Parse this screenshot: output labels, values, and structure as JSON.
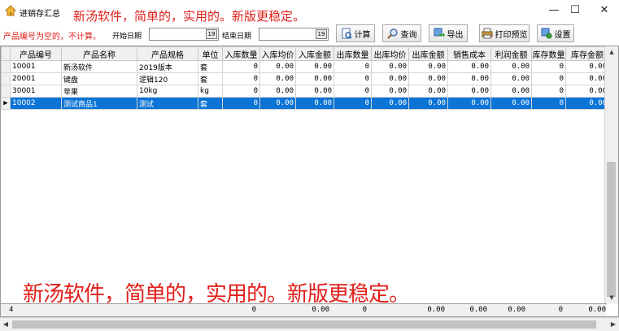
{
  "window": {
    "title": "进销存汇总",
    "banner": "新汤软件，简单的，实用的。新版更稳定。",
    "controls": {
      "minimize": "—",
      "maximize": "☐",
      "close": "✕"
    }
  },
  "toolbar": {
    "warning": "产品编号为空的，不计算。",
    "start_label": "开始日期",
    "start_value": "",
    "end_label": "结束日期",
    "end_value": "",
    "date_btn": "19",
    "buttons": {
      "calc": "计算",
      "query": "查询",
      "export": "导出",
      "print_preview": "打印预览",
      "settings": "设置"
    }
  },
  "grid": {
    "columns": [
      "产品编号",
      "产品名称",
      "产品规格",
      "单位",
      "入库数量",
      "入库均价",
      "入库金额",
      "出库数量",
      "出库均价",
      "出库金额",
      "销售成本",
      "利润金额",
      "库存数量",
      "库存金额"
    ],
    "rows": [
      {
        "code": "10001",
        "name": "新汤软件",
        "spec": "2019版本",
        "unit": "套",
        "in_qty": "0",
        "in_avg": "0.00",
        "in_amt": "0.00",
        "out_qty": "0",
        "out_avg": "0.00",
        "out_amt": "0.00",
        "cost": "0.00",
        "profit": "0.00",
        "stock_qty": "0",
        "stock_amt": "0.00"
      },
      {
        "code": "20001",
        "name": "键盘",
        "spec": "逻辑120",
        "unit": "套",
        "in_qty": "0",
        "in_avg": "0.00",
        "in_amt": "0.00",
        "out_qty": "0",
        "out_avg": "0.00",
        "out_amt": "0.00",
        "cost": "0.00",
        "profit": "0.00",
        "stock_qty": "0",
        "stock_amt": "0.00"
      },
      {
        "code": "30001",
        "name": "苹果",
        "spec": "10kg",
        "unit": "kg",
        "in_qty": "0",
        "in_avg": "0.00",
        "in_amt": "0.00",
        "out_qty": "0",
        "out_avg": "0.00",
        "out_amt": "0.00",
        "cost": "0.00",
        "profit": "0.00",
        "stock_qty": "0",
        "stock_amt": "0.00"
      },
      {
        "code": "10002",
        "name": "测试商品1",
        "spec": "测试",
        "unit": "套",
        "in_qty": "0",
        "in_avg": "0.00",
        "in_amt": "0.00",
        "out_qty": "0",
        "out_avg": "0.00",
        "out_amt": "0.00",
        "cost": "0.00",
        "profit": "0.00",
        "stock_qty": "0",
        "stock_amt": "0.00"
      }
    ],
    "selected_index": 3,
    "row_marker": "▶",
    "footer": {
      "count": "4",
      "in_qty": "0",
      "in_amt": "0.00",
      "out_qty": "0",
      "out_amt": "0.00",
      "cost": "0.00",
      "profit": "0.00",
      "stock_qty": "0",
      "stock_amt": "0.00"
    }
  },
  "watermark": "新汤软件，简单的，实用的。新版更稳定。",
  "colors": {
    "accent_red": "#e0201b",
    "selection_blue": "#0b74d6"
  },
  "icons": [
    "home-icon",
    "calculator-icon",
    "search-icon",
    "export-icon",
    "printer-icon",
    "settings-icon",
    "calendar-icon"
  ]
}
